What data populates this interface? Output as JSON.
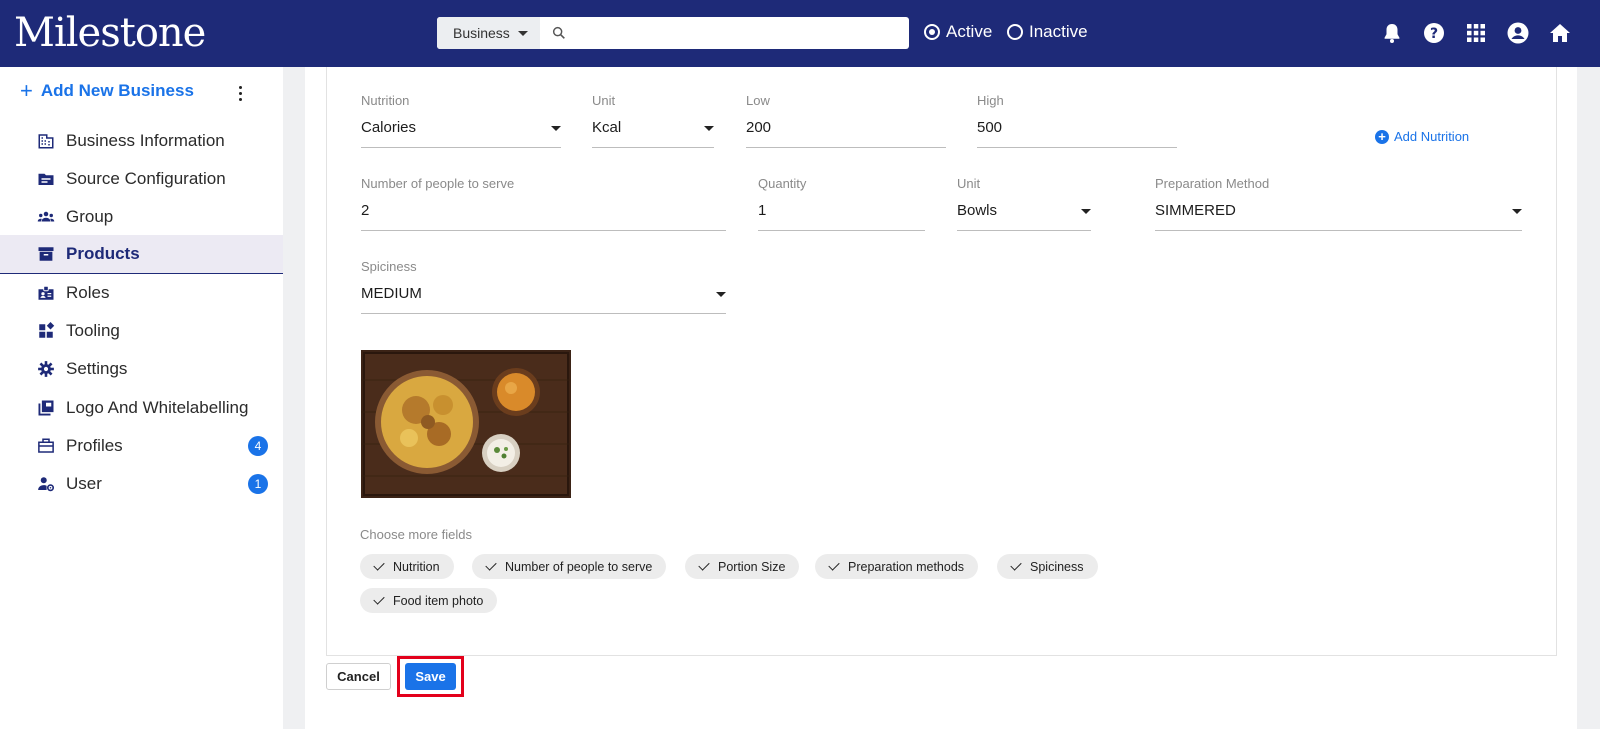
{
  "header": {
    "logo": "Milestone",
    "search": {
      "type_label": "Business",
      "placeholder": "",
      "value": ""
    },
    "status_filter": {
      "options": [
        {
          "label": "Active",
          "selected": true
        },
        {
          "label": "Inactive",
          "selected": false
        }
      ]
    },
    "icons": [
      "bell-icon",
      "help-icon",
      "apps-grid-icon",
      "account-circle-icon",
      "home-icon"
    ]
  },
  "sidebar": {
    "add_label": "Add New Business",
    "items": [
      {
        "label": "Business Information",
        "icon": "building-icon",
        "active": false
      },
      {
        "label": "Source Configuration",
        "icon": "folder-icon",
        "active": false
      },
      {
        "label": "Group",
        "icon": "group-icon",
        "active": false
      },
      {
        "label": "Products",
        "icon": "archive-icon",
        "active": true
      },
      {
        "label": "Roles",
        "icon": "badge-icon",
        "active": false
      },
      {
        "label": "Tooling",
        "icon": "widgets-icon",
        "active": false
      },
      {
        "label": "Settings",
        "icon": "gear-icon",
        "active": false
      },
      {
        "label": "Logo And Whitelabelling",
        "icon": "library-icon",
        "active": false
      },
      {
        "label": "Profiles",
        "icon": "briefcase-icon",
        "active": false,
        "badge": "4"
      },
      {
        "label": "User",
        "icon": "user-settings-icon",
        "active": false,
        "badge": "1"
      }
    ]
  },
  "form": {
    "nutrition": {
      "label": "Nutrition",
      "value": "Calories"
    },
    "nutrition_unit": {
      "label": "Unit",
      "value": "Kcal"
    },
    "low": {
      "label": "Low",
      "value": "200"
    },
    "high": {
      "label": "High",
      "value": "500"
    },
    "add_nutrition_label": "Add Nutrition",
    "people": {
      "label": "Number of people to serve",
      "value": "2"
    },
    "quantity": {
      "label": "Quantity",
      "value": "1"
    },
    "quantity_unit": {
      "label": "Unit",
      "value": "Bowls"
    },
    "preparation": {
      "label": "Preparation Method",
      "value": "SIMMERED"
    },
    "spiciness": {
      "label": "Spiciness",
      "value": "MEDIUM"
    },
    "more_fields_label": "Choose more fields",
    "chips": [
      "Nutrition",
      "Number of people to serve",
      "Portion Size",
      "Preparation methods",
      "Spiciness",
      "Food item photo"
    ]
  },
  "actions": {
    "cancel_label": "Cancel",
    "save_label": "Save"
  },
  "colors": {
    "header_bg": "#1e2a78",
    "accent": "#1a73e8",
    "highlight": "#e3001b"
  }
}
